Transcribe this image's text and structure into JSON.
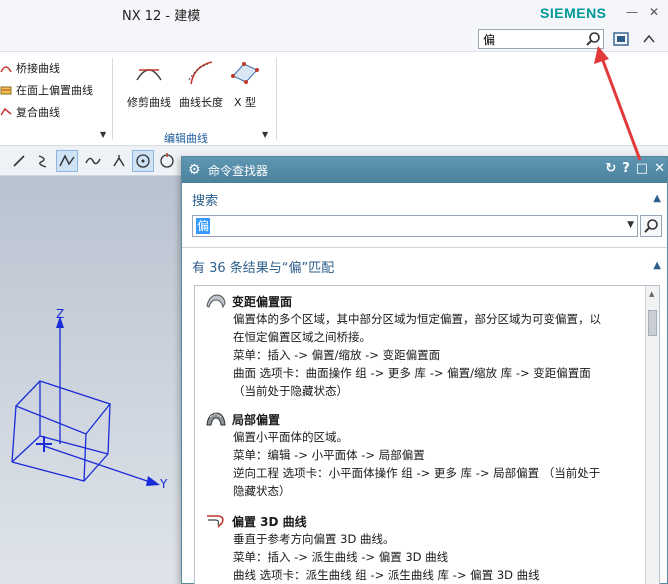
{
  "window": {
    "title": "NX 12 - 建模",
    "brand": "SIEMENS"
  },
  "ribbon": {
    "search_value": "偏",
    "items": [
      {
        "label": "桥接曲线"
      },
      {
        "label": "在面上偏置曲线"
      },
      {
        "label": "复合曲线"
      }
    ],
    "big_buttons": [
      {
        "label": "修剪曲线"
      },
      {
        "label": "曲线长度"
      },
      {
        "label": "X 型"
      }
    ],
    "group_label": "编辑曲线"
  },
  "dialog": {
    "title": "命令查找器",
    "search_label": "搜索",
    "search_value": "偏",
    "results_header": "有 36 条结果与“偏”匹配",
    "results": [
      {
        "name": "变距偏置面",
        "lines": [
          "偏置体的多个区域，其中部分区域为恒定偏置，部分区域为可变偏置，以",
          "在恒定偏置区域之间桥接。",
          "菜单：插入 -> 偏置/缩放 -> 变距偏置面",
          "曲面 选项卡：曲面操作 组 -> 更多 库 -> 偏置/缩放 库 -> 变距偏置面",
          "（当前处于隐藏状态）"
        ]
      },
      {
        "name": "局部偏置",
        "lines": [
          "偏置小平面体的区域。",
          "菜单：编辑 -> 小平面体 -> 局部偏置",
          "逆向工程 选项卡：小平面体操作 组 -> 更多 库 -> 局部偏置 （当前处于",
          "隐藏状态）"
        ]
      },
      {
        "name": "偏置 3D 曲线",
        "lines": [
          "垂直于参考方向偏置 3D 曲线。",
          "菜单：插入 -> 派生曲线 -> 偏置 3D 曲线",
          "曲线 选项卡：派生曲线 组 -> 派生曲线 库 -> 偏置 3D 曲线"
        ]
      }
    ]
  },
  "viewport": {
    "axis_labels": {
      "z": "Z",
      "y": "Y"
    }
  },
  "colors": {
    "brand": "#009999",
    "dialog_header": "#4a819d",
    "section_text": "#2d5e8b",
    "annotation_arrow": "#e23a3a"
  }
}
